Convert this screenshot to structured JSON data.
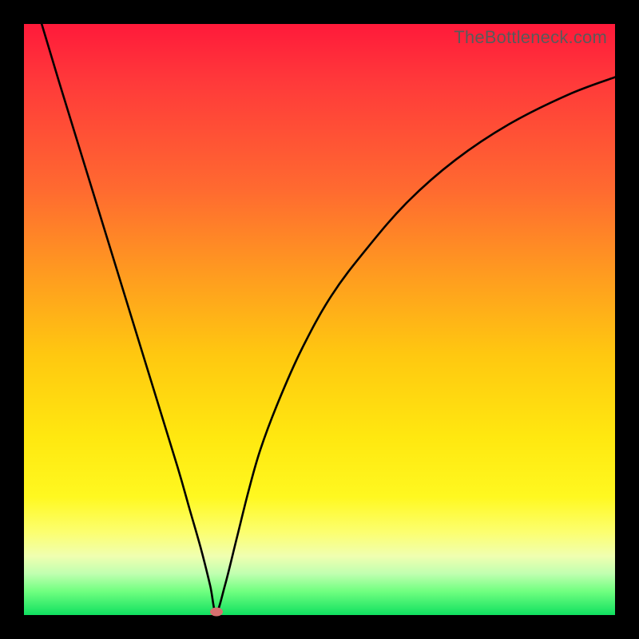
{
  "watermark": "TheBottleneck.com",
  "colors": {
    "frame": "#000000",
    "curve": "#000000",
    "marker": "#d87070"
  },
  "chart_data": {
    "type": "line",
    "title": "",
    "xlabel": "",
    "ylabel": "",
    "xlim": [
      0,
      100
    ],
    "ylim": [
      0,
      100
    ],
    "grid": false,
    "legend": false,
    "series": [
      {
        "name": "bottleneck-curve",
        "x": [
          3,
          6,
          10,
          14,
          18,
          22,
          26,
          28,
          30,
          31.5,
          32.5,
          34,
          36,
          38,
          40,
          43,
          47,
          52,
          58,
          65,
          73,
          82,
          92,
          100
        ],
        "y": [
          100,
          90,
          77,
          64,
          51,
          38,
          25,
          18,
          11,
          5,
          0.5,
          5,
          13,
          21,
          28,
          36,
          45,
          54,
          62,
          70,
          77,
          83,
          88,
          91
        ]
      }
    ],
    "marker": {
      "x": 32.5,
      "y": 0.5
    },
    "background_gradient": {
      "top": "#ff1a3a",
      "mid": "#ffe810",
      "bottom": "#10e060"
    }
  }
}
